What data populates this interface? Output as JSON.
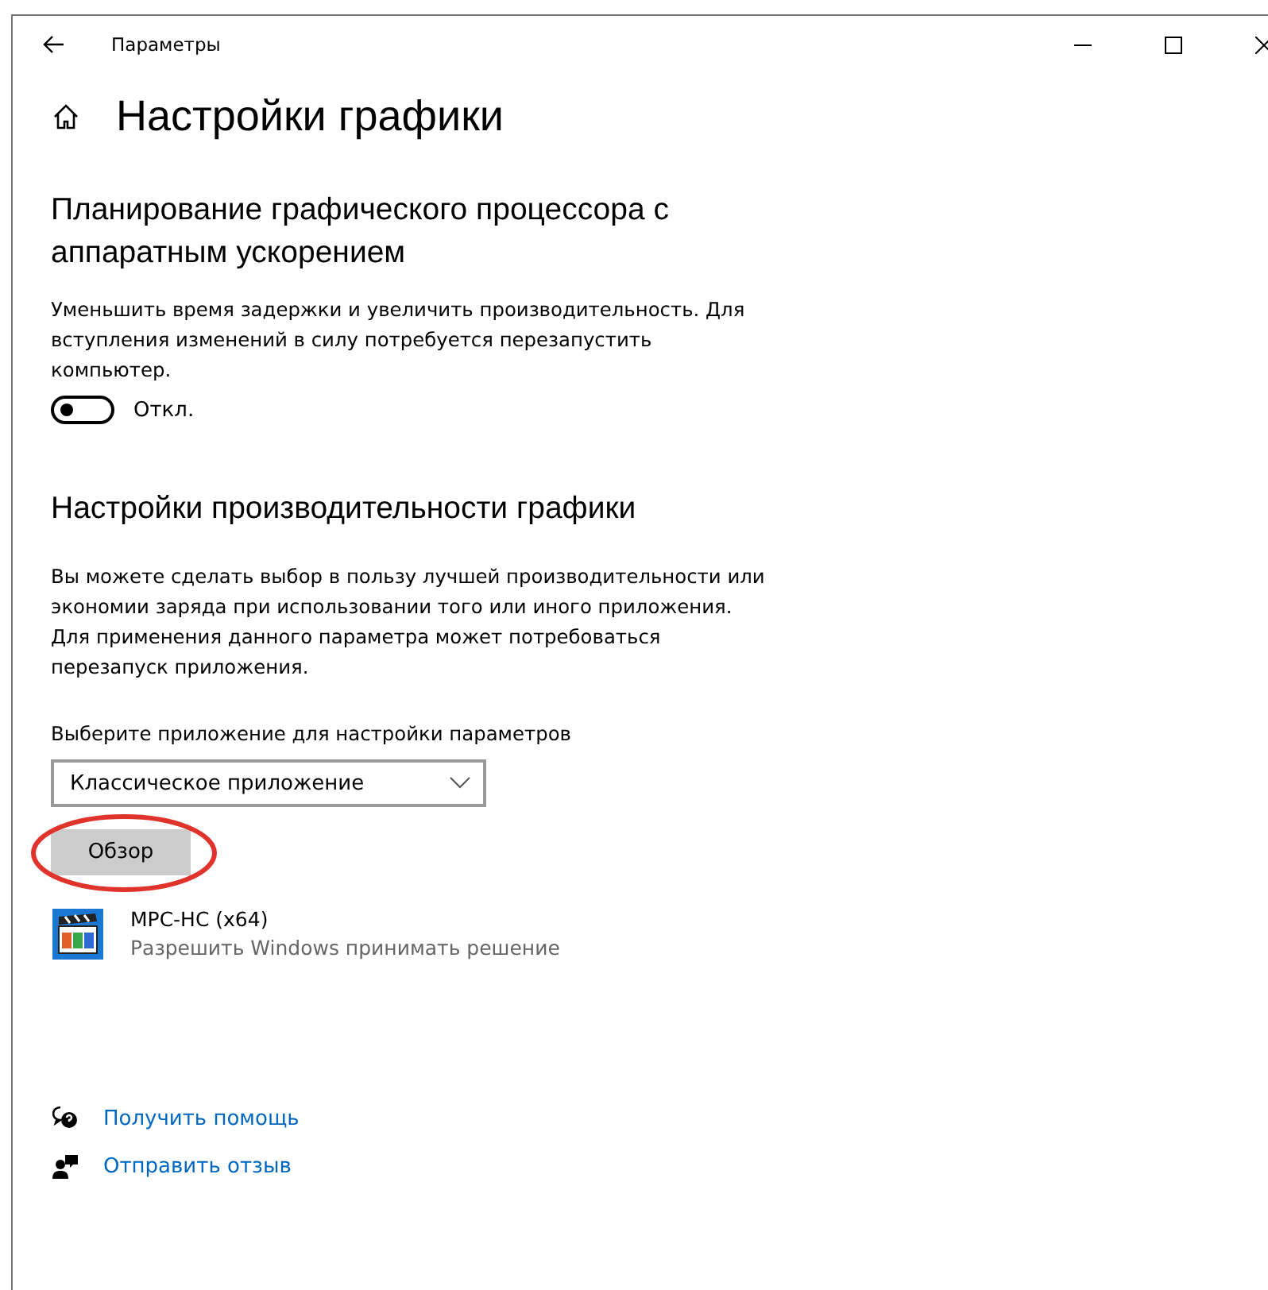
{
  "window": {
    "title": "Параметры"
  },
  "page_title": "Настройки графики",
  "gpu_scheduling": {
    "heading": "Планирование графического процессора с аппаратным ускорением",
    "description": "Уменьшить время задержки и увеличить производительность. Для вступления изменений в силу потребуется перезапустить компьютер.",
    "toggle": {
      "on": false,
      "label": "Откл."
    }
  },
  "performance": {
    "heading": "Настройки производительности графики",
    "description": "Вы можете сделать выбор в пользу лучшей производительности или экономии заряда при использовании того или иного приложения. Для применения данного параметра может потребоваться перезапуск приложения.",
    "select_label": "Выберите приложение для настройки параметров",
    "select_value": "Классическое приложение",
    "browse_button": "Обзор",
    "browse_highlighted": true,
    "apps": [
      {
        "name": "MPC-HC (x64)",
        "setting": "Разрешить Windows принимать решение"
      }
    ]
  },
  "links": [
    {
      "kind": "help",
      "label": "Получить помощь"
    },
    {
      "kind": "feedback",
      "label": "Отправить отзыв"
    }
  ]
}
